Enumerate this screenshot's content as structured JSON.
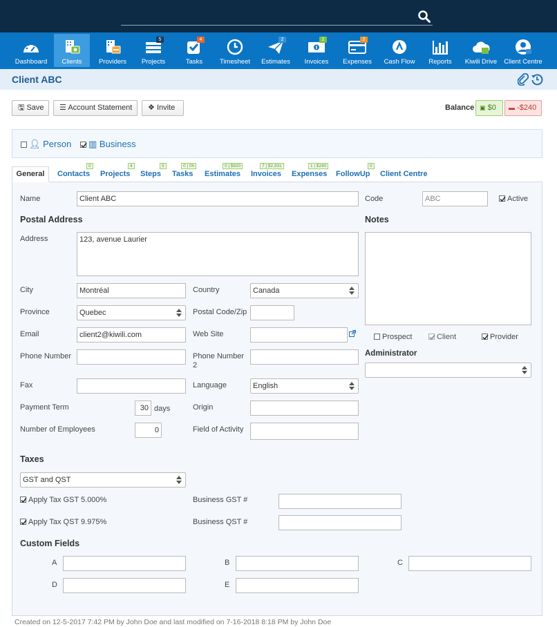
{
  "nav": {
    "items": [
      {
        "label": "Dashboard",
        "icon": "dashboard-icon",
        "badge": ""
      },
      {
        "label": "Clients",
        "icon": "clients-icon",
        "badge": ""
      },
      {
        "label": "Providers",
        "icon": "providers-icon",
        "badge": ""
      },
      {
        "label": "Projects",
        "icon": "projects-icon",
        "badge": "5"
      },
      {
        "label": "Tasks",
        "icon": "tasks-icon",
        "badge": "4"
      },
      {
        "label": "Timesheet",
        "icon": "timesheet-icon",
        "badge": ""
      },
      {
        "label": "Estimates",
        "icon": "estimates-icon",
        "badge": "2"
      },
      {
        "label": "Invoices",
        "icon": "invoices-icon",
        "badge": "2"
      },
      {
        "label": "Expenses",
        "icon": "expenses-icon",
        "badge": "2"
      },
      {
        "label": "Cash Flow",
        "icon": "cash-flow-icon",
        "badge": ""
      },
      {
        "label": "Reports",
        "icon": "reports-icon",
        "badge": ""
      },
      {
        "label": "Kiwili Drive",
        "icon": "cloud-drive-icon",
        "badge": ""
      },
      {
        "label": "Client Centre",
        "icon": "client-centre-icon",
        "badge": ""
      }
    ],
    "active": "Clients"
  },
  "page": {
    "title": "Client ABC"
  },
  "toolbar": {
    "save": "Save",
    "statement": "Account Statement",
    "invite": "Invite"
  },
  "balance": {
    "label": "Balance",
    "positive": "$0",
    "negative": "-$240"
  },
  "type": {
    "person": "Person",
    "business": "Business",
    "person_checked": false,
    "business_checked": true
  },
  "tabs": [
    {
      "label": "General",
      "count": ""
    },
    {
      "label": "Contacts",
      "count": "0"
    },
    {
      "label": "Projects",
      "count": "4"
    },
    {
      "label": "Steps",
      "count": "5"
    },
    {
      "label": "Tasks",
      "count": "0 | 0h"
    },
    {
      "label": "Estimates",
      "count": "0 | $920"
    },
    {
      "label": "Invoices",
      "count": "7 | $2,931"
    },
    {
      "label": "Expenses",
      "count": "1 | $240"
    },
    {
      "label": "FollowUp",
      "count": "0"
    },
    {
      "label": "Client Centre",
      "count": ""
    }
  ],
  "form": {
    "name_label": "Name",
    "name": "Client ABC",
    "code_label": "Code",
    "code_placeholder": "ABC",
    "active_label": "Active",
    "postal_title": "Postal Address",
    "notes_title": "Notes",
    "address_label": "Address",
    "address": "123, avenue Laurier",
    "city_label": "City",
    "city": "Montréal",
    "country_label": "Country",
    "country": "Canada",
    "province_label": "Province",
    "province": "Quebec",
    "postal_label": "Postal Code/Zip",
    "postal": "",
    "email_label": "Email",
    "email": "client2@kiwili.com",
    "website_label": "Web Site",
    "website": "",
    "phone_label": "Phone Number",
    "phone": "",
    "phone2_label": "Phone Number 2",
    "phone2": "",
    "fax_label": "Fax",
    "fax": "",
    "language_label": "Language",
    "language": "English",
    "payment_label": "Payment Term",
    "payment": "30",
    "payment_unit": "days",
    "origin_label": "Origin",
    "origin": "",
    "employees_label": "Number of Employees",
    "employees": "0",
    "activity_label": "Field of Activity",
    "activity": "",
    "prospect_label": "Prospect",
    "client_label": "Client",
    "provider_label": "Provider",
    "admin_title": "Administrator",
    "admin": ""
  },
  "taxes": {
    "title": "Taxes",
    "scheme": "GST and QST",
    "gst_label": "Apply Tax GST 5.000%",
    "qst_label": "Apply Tax QST 9.975%",
    "bgst_label": "Business GST #",
    "bqst_label": "Business QST #"
  },
  "custom": {
    "title": "Custom Fields",
    "a": "A",
    "b": "B",
    "c": "C",
    "d": "D",
    "e": "E"
  },
  "footer": "Created on 12-5-2017 7:42 PM by John Doe and last modified on 7-16-2018 8:18 PM by John Doe",
  "colors": {
    "topbar": "#0d2b45",
    "navbar": "#0b75c5",
    "accent": "#1e6fb3",
    "badge_blue": "#2a6fb0",
    "badge_orange": "#e8672c",
    "badge_green": "#7cbf3e"
  }
}
